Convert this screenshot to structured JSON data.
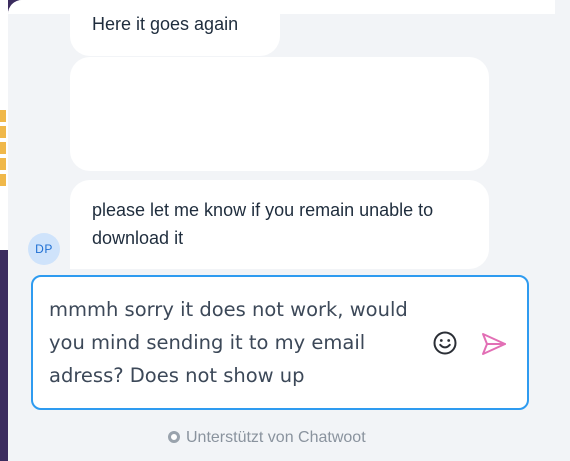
{
  "messages": [
    {
      "text": "Here it goes again"
    },
    {
      "text": ""
    },
    {
      "text": "please let me know if you remain unable to download it"
    }
  ],
  "agent": {
    "initials": "DP"
  },
  "composer": {
    "value": "mmmh sorry it does not work, would you mind sending it to my email adress? Does not show up"
  },
  "icons": {
    "emoji": "smiley-icon",
    "send": "send-icon"
  },
  "footer": {
    "powered_by": "Unterstützt von Chatwoot"
  },
  "colors": {
    "accent": "#2e9bf0",
    "send": "#e26fb5",
    "background": "#f2f4f7"
  }
}
